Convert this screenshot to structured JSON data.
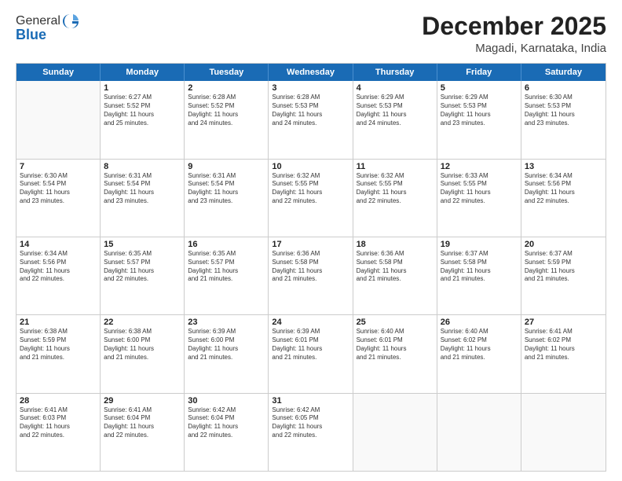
{
  "logo": {
    "general": "General",
    "blue": "Blue"
  },
  "header": {
    "month": "December 2025",
    "location": "Magadi, Karnataka, India"
  },
  "weekdays": [
    "Sunday",
    "Monday",
    "Tuesday",
    "Wednesday",
    "Thursday",
    "Friday",
    "Saturday"
  ],
  "rows": [
    [
      {
        "day": "",
        "info": ""
      },
      {
        "day": "1",
        "info": "Sunrise: 6:27 AM\nSunset: 5:52 PM\nDaylight: 11 hours\nand 25 minutes."
      },
      {
        "day": "2",
        "info": "Sunrise: 6:28 AM\nSunset: 5:52 PM\nDaylight: 11 hours\nand 24 minutes."
      },
      {
        "day": "3",
        "info": "Sunrise: 6:28 AM\nSunset: 5:53 PM\nDaylight: 11 hours\nand 24 minutes."
      },
      {
        "day": "4",
        "info": "Sunrise: 6:29 AM\nSunset: 5:53 PM\nDaylight: 11 hours\nand 24 minutes."
      },
      {
        "day": "5",
        "info": "Sunrise: 6:29 AM\nSunset: 5:53 PM\nDaylight: 11 hours\nand 23 minutes."
      },
      {
        "day": "6",
        "info": "Sunrise: 6:30 AM\nSunset: 5:53 PM\nDaylight: 11 hours\nand 23 minutes."
      }
    ],
    [
      {
        "day": "7",
        "info": "Sunrise: 6:30 AM\nSunset: 5:54 PM\nDaylight: 11 hours\nand 23 minutes."
      },
      {
        "day": "8",
        "info": "Sunrise: 6:31 AM\nSunset: 5:54 PM\nDaylight: 11 hours\nand 23 minutes."
      },
      {
        "day": "9",
        "info": "Sunrise: 6:31 AM\nSunset: 5:54 PM\nDaylight: 11 hours\nand 23 minutes."
      },
      {
        "day": "10",
        "info": "Sunrise: 6:32 AM\nSunset: 5:55 PM\nDaylight: 11 hours\nand 22 minutes."
      },
      {
        "day": "11",
        "info": "Sunrise: 6:32 AM\nSunset: 5:55 PM\nDaylight: 11 hours\nand 22 minutes."
      },
      {
        "day": "12",
        "info": "Sunrise: 6:33 AM\nSunset: 5:55 PM\nDaylight: 11 hours\nand 22 minutes."
      },
      {
        "day": "13",
        "info": "Sunrise: 6:34 AM\nSunset: 5:56 PM\nDaylight: 11 hours\nand 22 minutes."
      }
    ],
    [
      {
        "day": "14",
        "info": "Sunrise: 6:34 AM\nSunset: 5:56 PM\nDaylight: 11 hours\nand 22 minutes."
      },
      {
        "day": "15",
        "info": "Sunrise: 6:35 AM\nSunset: 5:57 PM\nDaylight: 11 hours\nand 22 minutes."
      },
      {
        "day": "16",
        "info": "Sunrise: 6:35 AM\nSunset: 5:57 PM\nDaylight: 11 hours\nand 21 minutes."
      },
      {
        "day": "17",
        "info": "Sunrise: 6:36 AM\nSunset: 5:58 PM\nDaylight: 11 hours\nand 21 minutes."
      },
      {
        "day": "18",
        "info": "Sunrise: 6:36 AM\nSunset: 5:58 PM\nDaylight: 11 hours\nand 21 minutes."
      },
      {
        "day": "19",
        "info": "Sunrise: 6:37 AM\nSunset: 5:58 PM\nDaylight: 11 hours\nand 21 minutes."
      },
      {
        "day": "20",
        "info": "Sunrise: 6:37 AM\nSunset: 5:59 PM\nDaylight: 11 hours\nand 21 minutes."
      }
    ],
    [
      {
        "day": "21",
        "info": "Sunrise: 6:38 AM\nSunset: 5:59 PM\nDaylight: 11 hours\nand 21 minutes."
      },
      {
        "day": "22",
        "info": "Sunrise: 6:38 AM\nSunset: 6:00 PM\nDaylight: 11 hours\nand 21 minutes."
      },
      {
        "day": "23",
        "info": "Sunrise: 6:39 AM\nSunset: 6:00 PM\nDaylight: 11 hours\nand 21 minutes."
      },
      {
        "day": "24",
        "info": "Sunrise: 6:39 AM\nSunset: 6:01 PM\nDaylight: 11 hours\nand 21 minutes."
      },
      {
        "day": "25",
        "info": "Sunrise: 6:40 AM\nSunset: 6:01 PM\nDaylight: 11 hours\nand 21 minutes."
      },
      {
        "day": "26",
        "info": "Sunrise: 6:40 AM\nSunset: 6:02 PM\nDaylight: 11 hours\nand 21 minutes."
      },
      {
        "day": "27",
        "info": "Sunrise: 6:41 AM\nSunset: 6:02 PM\nDaylight: 11 hours\nand 21 minutes."
      }
    ],
    [
      {
        "day": "28",
        "info": "Sunrise: 6:41 AM\nSunset: 6:03 PM\nDaylight: 11 hours\nand 22 minutes."
      },
      {
        "day": "29",
        "info": "Sunrise: 6:41 AM\nSunset: 6:04 PM\nDaylight: 11 hours\nand 22 minutes."
      },
      {
        "day": "30",
        "info": "Sunrise: 6:42 AM\nSunset: 6:04 PM\nDaylight: 11 hours\nand 22 minutes."
      },
      {
        "day": "31",
        "info": "Sunrise: 6:42 AM\nSunset: 6:05 PM\nDaylight: 11 hours\nand 22 minutes."
      },
      {
        "day": "",
        "info": ""
      },
      {
        "day": "",
        "info": ""
      },
      {
        "day": "",
        "info": ""
      }
    ]
  ]
}
